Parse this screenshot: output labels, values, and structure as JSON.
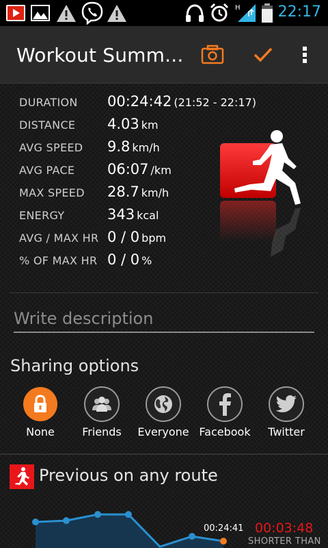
{
  "status_bar": {
    "time": "22:17",
    "left_icons": [
      "youtube-icon",
      "gallery-icon",
      "warning-icon",
      "viber-icon",
      "warning-icon"
    ],
    "right_icons": [
      "headphones-icon",
      "alarm-icon",
      "signal-hplus-icon",
      "battery-icon"
    ],
    "signal_label": "H"
  },
  "action_bar": {
    "title": "Workout Summ...",
    "actions": [
      "camera-icon",
      "check-icon",
      "overflow-menu-icon"
    ],
    "accent_color": "#f47a1f"
  },
  "stats": [
    {
      "label": "DURATION",
      "value": "00:24:42",
      "unit": "(21:52 - 22:17)"
    },
    {
      "label": "DISTANCE",
      "value": "4.03",
      "unit": "km"
    },
    {
      "label": "AVG SPEED",
      "value": "9.8",
      "unit": "km/h"
    },
    {
      "label": "AVG PACE",
      "value": "06:07",
      "unit": "/km"
    },
    {
      "label": "MAX SPEED",
      "value": "28.7",
      "unit": "km/h"
    },
    {
      "label": "ENERGY",
      "value": "343",
      "unit": "kcal"
    },
    {
      "label": "AVG / MAX HR",
      "value": "0 / 0",
      "unit": "bpm"
    },
    {
      "label": "% OF MAX HR",
      "value": "0 / 0",
      "unit": "%"
    }
  ],
  "description": {
    "placeholder": "Write description",
    "value": ""
  },
  "sharing": {
    "title": "Sharing options",
    "options": [
      {
        "label": "None",
        "icon": "lock-icon",
        "selected": true
      },
      {
        "label": "Friends",
        "icon": "friends-icon",
        "selected": false
      },
      {
        "label": "Everyone",
        "icon": "globe-icon",
        "selected": false
      },
      {
        "label": "Facebook",
        "icon": "facebook-icon",
        "selected": false
      },
      {
        "label": "Twitter",
        "icon": "twitter-icon",
        "selected": false
      }
    ]
  },
  "previous": {
    "title": "Previous on any route",
    "time": "00:24:41",
    "difference": "00:03:48",
    "comparison": "SHORTER THAN",
    "difference_color": "#e8161a"
  }
}
